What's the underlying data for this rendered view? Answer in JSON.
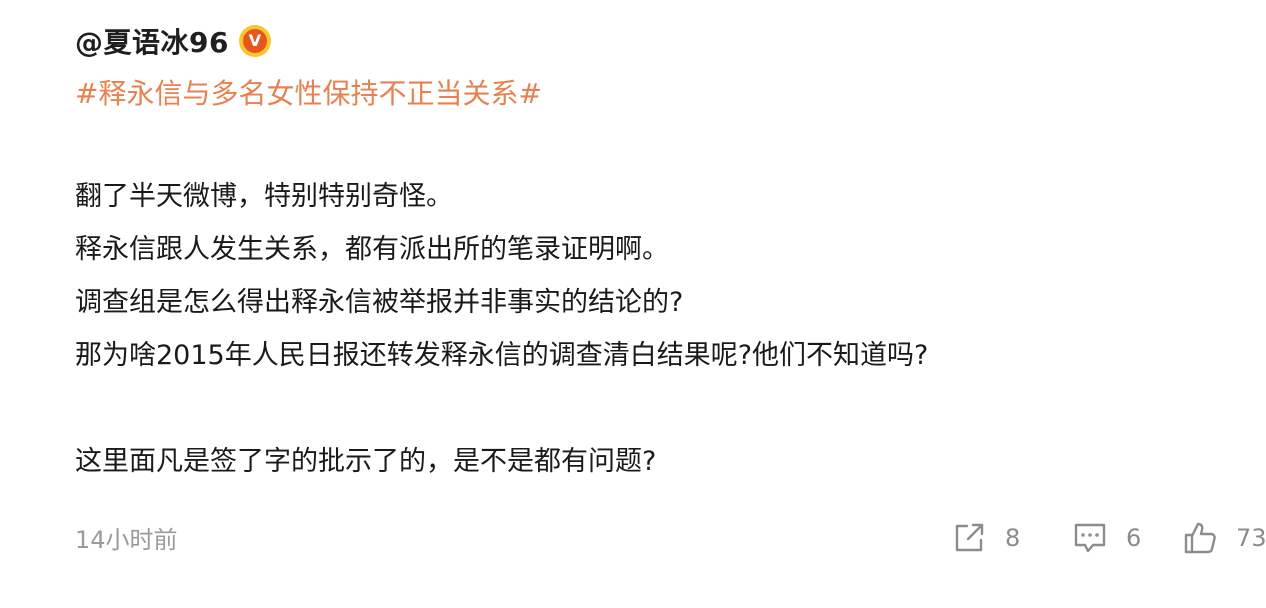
{
  "author": {
    "mention": "@夏语冰96",
    "verified_badge": "V"
  },
  "hashtag": "#释永信与多名女性保持不正当关系#",
  "body_lines": [
    "翻了半天微博，特别特别奇怪。",
    "释永信跟人发生关系，都有派出所的笔录证明啊。",
    "调查组是怎么得出释永信被举报并非事实的结论的?",
    "那为啥2015年人民日报还转发释永信的调查清白结果呢?他们不知道吗?",
    "",
    "这里面凡是签了字的批示了的，是不是都有问题?"
  ],
  "footer": {
    "timestamp": "14小时前",
    "forward_count": "8",
    "comment_count": "6",
    "like_count": "73"
  },
  "colors": {
    "hashtag": "#e8814f",
    "badge_outer": "#f7c82e",
    "badge_inner": "#e8551d",
    "meta_text": "#9a9a9a"
  },
  "icons": {
    "forward": "share-forward-icon",
    "comment": "comment-bubble-icon",
    "like": "thumbs-up-icon"
  }
}
